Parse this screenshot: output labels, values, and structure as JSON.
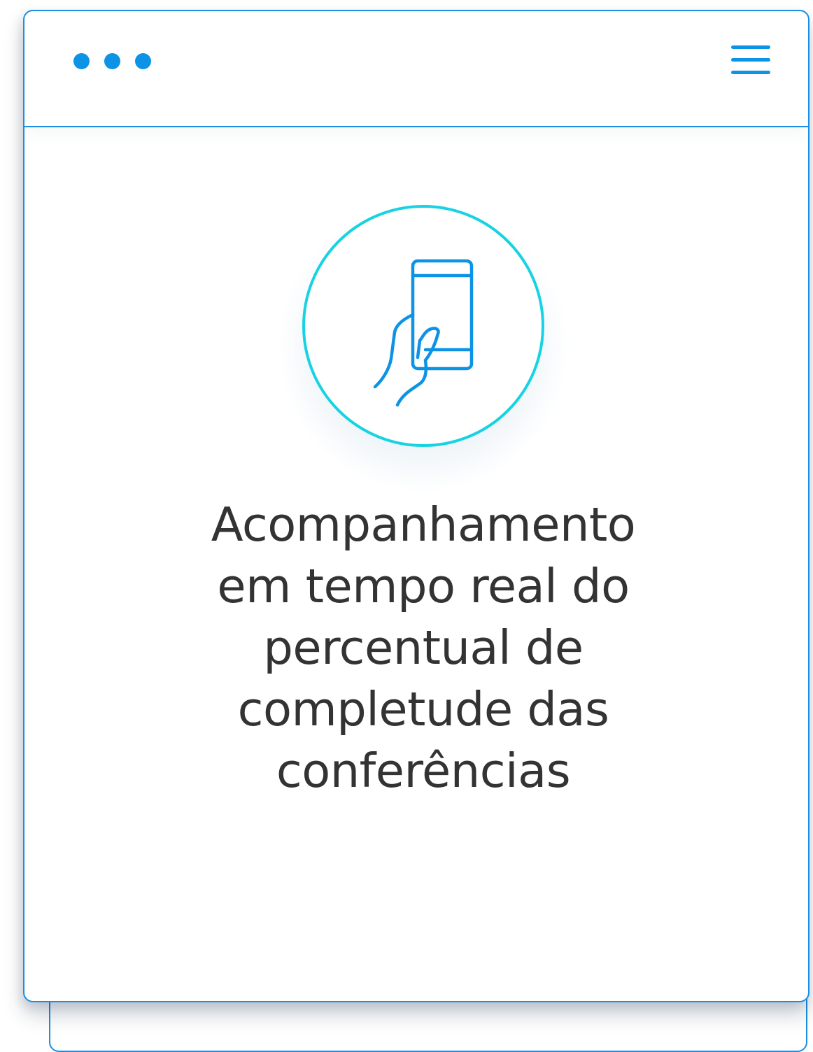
{
  "theme": {
    "accent": "#0d93e6",
    "circle_border": "#17d3e2",
    "text_color": "#333333"
  },
  "header": {
    "dots_icon": "ellipsis-icon",
    "menu_icon": "hamburger-menu-icon"
  },
  "feature": {
    "icon": "hand-holding-phone-icon",
    "title_lines": [
      "Acompanhamento",
      "em tempo real do",
      "percentual de",
      "completude das",
      "conferências"
    ]
  }
}
